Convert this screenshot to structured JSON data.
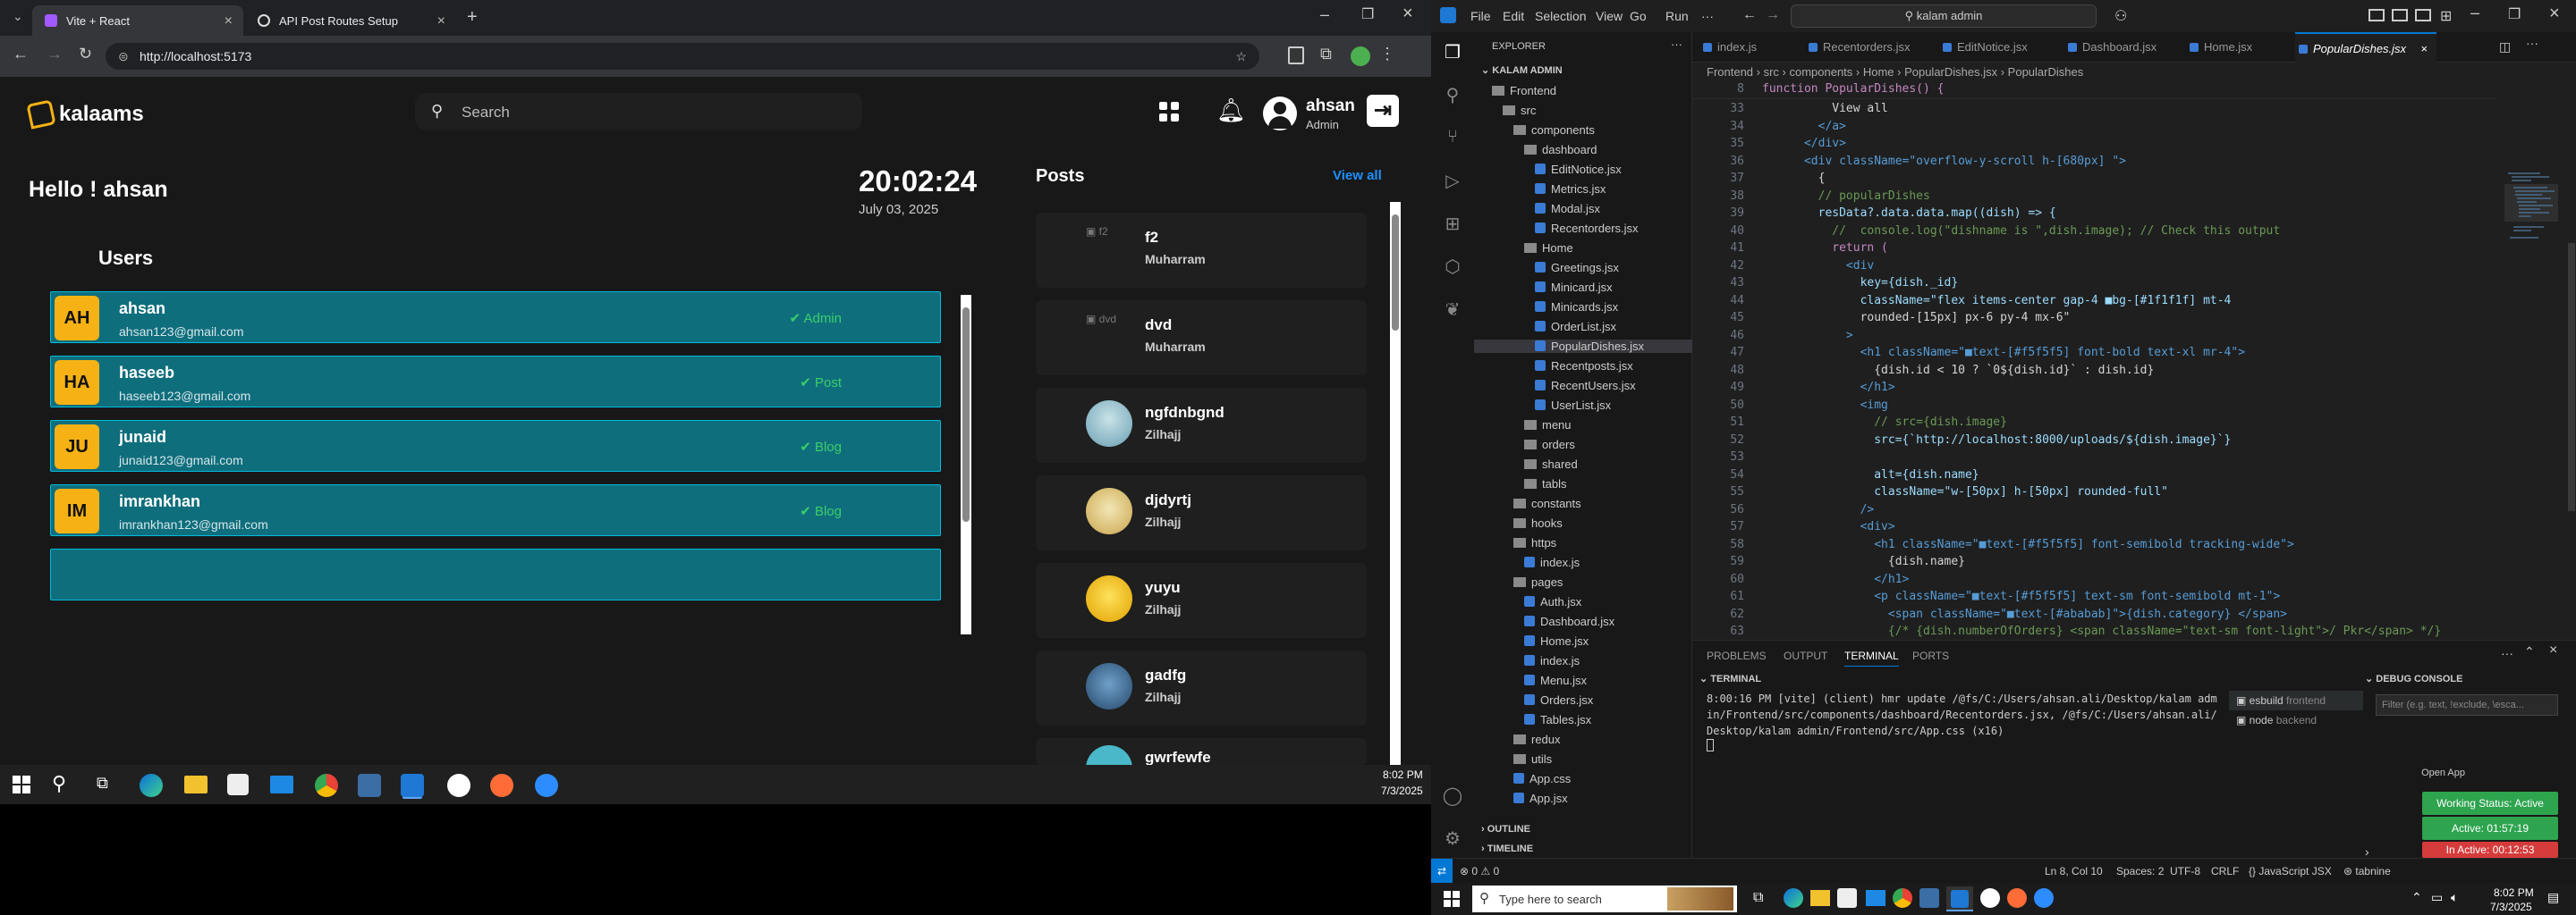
{
  "browser": {
    "tabs": [
      {
        "title": "Vite + React",
        "active": true
      },
      {
        "title": "API Post Routes Setup",
        "active": false
      }
    ],
    "new_tab": "+",
    "url": "http://localhost:5173"
  },
  "app": {
    "logo": "kalaams",
    "search_placeholder": "Search",
    "profile": {
      "name": "ahsan",
      "role": "Admin"
    },
    "greeting": "Hello ! ahsan",
    "clock": {
      "time": "20:02:24",
      "date": "July 03, 2025"
    },
    "users": {
      "title": "Users",
      "rows": [
        {
          "initials": "AH",
          "name": "ahsan",
          "email": "ahsan123@gmail.com",
          "role": "Admin"
        },
        {
          "initials": "HA",
          "name": "haseeb",
          "email": "haseeb123@gmail.com",
          "role": "Post"
        },
        {
          "initials": "JU",
          "name": "junaid",
          "email": "junaid123@gmail.com",
          "role": "Blog"
        },
        {
          "initials": "IM",
          "name": "imrankhan",
          "email": "imrankhan123@gmail.com",
          "role": "Blog"
        }
      ]
    },
    "posts": {
      "title": "Posts",
      "view_all": "View all",
      "items": [
        {
          "title": "f2",
          "sub": "Muharram",
          "img_alt": "f2"
        },
        {
          "title": "dvd",
          "sub": "Muharram",
          "img_alt": "dvd"
        },
        {
          "title": "ngfdnbgnd",
          "sub": "Zilhajj",
          "img_alt": ""
        },
        {
          "title": "djdyrtj",
          "sub": "Zilhajj",
          "img_alt": ""
        },
        {
          "title": "yuyu",
          "sub": "Zilhajj",
          "img_alt": ""
        },
        {
          "title": "gadfg",
          "sub": "Zilhajj",
          "img_alt": ""
        },
        {
          "title": "gwrfewfe",
          "sub": "",
          "img_alt": ""
        }
      ]
    }
  },
  "taskbar_left": {
    "time": "8:02 PM",
    "date": "7/3/2025"
  },
  "vscode": {
    "menus": [
      "File",
      "Edit",
      "Selection",
      "View",
      "Go",
      "Run",
      "···"
    ],
    "command_center": "kalam admin",
    "explorer": {
      "title": "EXPLORER",
      "root": "KALAM ADMIN",
      "tree": [
        {
          "label": "Frontend",
          "type": "folder",
          "depth": 1
        },
        {
          "label": "src",
          "type": "folder",
          "depth": 2
        },
        {
          "label": "components",
          "type": "folder",
          "depth": 3
        },
        {
          "label": "dashboard",
          "type": "folder",
          "depth": 4
        },
        {
          "label": "EditNotice.jsx",
          "type": "file",
          "depth": 5
        },
        {
          "label": "Metrics.jsx",
          "type": "file",
          "depth": 5
        },
        {
          "label": "Modal.jsx",
          "type": "file",
          "depth": 5
        },
        {
          "label": "Recentorders.jsx",
          "type": "file",
          "depth": 5
        },
        {
          "label": "Home",
          "type": "folder",
          "depth": 4
        },
        {
          "label": "Greetings.jsx",
          "type": "file",
          "depth": 5
        },
        {
          "label": "Minicard.jsx",
          "type": "file",
          "depth": 5
        },
        {
          "label": "Minicards.jsx",
          "type": "file",
          "depth": 5
        },
        {
          "label": "OrderList.jsx",
          "type": "file",
          "depth": 5
        },
        {
          "label": "PopularDishes.jsx",
          "type": "file",
          "depth": 5,
          "selected": true
        },
        {
          "label": "Recentposts.jsx",
          "type": "file",
          "depth": 5
        },
        {
          "label": "RecentUsers.jsx",
          "type": "file",
          "depth": 5
        },
        {
          "label": "UserList.jsx",
          "type": "file",
          "depth": 5
        },
        {
          "label": "menu",
          "type": "folder",
          "depth": 4
        },
        {
          "label": "orders",
          "type": "folder",
          "depth": 4
        },
        {
          "label": "shared",
          "type": "folder",
          "depth": 4
        },
        {
          "label": "tabls",
          "type": "folder",
          "depth": 4
        },
        {
          "label": "constants",
          "type": "folder",
          "depth": 3
        },
        {
          "label": "hooks",
          "type": "folder",
          "depth": 3
        },
        {
          "label": "https",
          "type": "folder",
          "depth": 3
        },
        {
          "label": "index.js",
          "type": "file",
          "depth": 4
        },
        {
          "label": "pages",
          "type": "folder",
          "depth": 3
        },
        {
          "label": "Auth.jsx",
          "type": "file",
          "depth": 4
        },
        {
          "label": "Dashboard.jsx",
          "type": "file",
          "depth": 4
        },
        {
          "label": "Home.jsx",
          "type": "file",
          "depth": 4
        },
        {
          "label": "index.js",
          "type": "file",
          "depth": 4
        },
        {
          "label": "Menu.jsx",
          "type": "file",
          "depth": 4
        },
        {
          "label": "Orders.jsx",
          "type": "file",
          "depth": 4
        },
        {
          "label": "Tables.jsx",
          "type": "file",
          "depth": 4
        },
        {
          "label": "redux",
          "type": "folder",
          "depth": 3
        },
        {
          "label": "utils",
          "type": "folder",
          "depth": 3
        },
        {
          "label": "App.css",
          "type": "file",
          "depth": 3
        },
        {
          "label": "App.jsx",
          "type": "file",
          "depth": 3
        }
      ],
      "outline": "OUTLINE",
      "timeline": "TIMELINE"
    },
    "editor_tabs": [
      "index.js",
      "Recentorders.jsx",
      "EditNotice.jsx",
      "Dashboard.jsx",
      "Home.jsx",
      "PopularDishes.jsx"
    ],
    "breadcrumb": "Frontend › src › components › Home › PopularDishes.jsx › PopularDishes",
    "sticky_line": {
      "num": "8",
      "text": "function PopularDishes() {"
    },
    "code": [
      {
        "n": "33",
        "t": "          View all"
      },
      {
        "n": "34",
        "t": "        </a>"
      },
      {
        "n": "35",
        "t": "      </div>"
      },
      {
        "n": "36",
        "t": "      <div className=\"overflow-y-scroll h-[680px] \">"
      },
      {
        "n": "37",
        "t": "        {"
      },
      {
        "n": "38",
        "t": "        // popularDishes"
      },
      {
        "n": "39",
        "t": "        resData?.data.data.map((dish) => {"
      },
      {
        "n": "40",
        "t": "          //  console.log(\"dishname is \",dish.image); // Check this output"
      },
      {
        "n": "41",
        "t": "          return ("
      },
      {
        "n": "42",
        "t": "            <div"
      },
      {
        "n": "43",
        "t": "              key={dish._id}"
      },
      {
        "n": "44",
        "t": "              className=\"flex items-center gap-4 ■bg-[#1f1f1f] mt-4"
      },
      {
        "n": "45",
        "t": "              rounded-[15px] px-6 py-4 mx-6\""
      },
      {
        "n": "46",
        "t": "            >"
      },
      {
        "n": "47",
        "t": "              <h1 className=\"■text-[#f5f5f5] font-bold text-xl mr-4\">"
      },
      {
        "n": "48",
        "t": "                {dish.id < 10 ? `0${dish.id}` : dish.id}"
      },
      {
        "n": "49",
        "t": "              </h1>"
      },
      {
        "n": "50",
        "t": "              <img"
      },
      {
        "n": "51",
        "t": "                // src={dish.image}"
      },
      {
        "n": "52",
        "t": "                src={`http://localhost:8000/uploads/${dish.image}`}"
      },
      {
        "n": "53",
        "t": ""
      },
      {
        "n": "54",
        "t": "                alt={dish.name}"
      },
      {
        "n": "55",
        "t": "                className=\"w-[50px] h-[50px] rounded-full\""
      },
      {
        "n": "56",
        "t": "              />"
      },
      {
        "n": "57",
        "t": "              <div>"
      },
      {
        "n": "58",
        "t": "                <h1 className=\"■text-[#f5f5f5] font-semibold tracking-wide\">"
      },
      {
        "n": "59",
        "t": "                  {dish.name}"
      },
      {
        "n": "60",
        "t": "                </h1>"
      },
      {
        "n": "61",
        "t": "                <p className=\"■text-[#f5f5f5] text-sm font-semibold mt-1\">"
      },
      {
        "n": "62",
        "t": "                  <span className=\"■text-[#ababab]\">{dish.category} </span>"
      },
      {
        "n": "63",
        "t": "                  {/* {dish.numberOfOrders} <span className=\"text-sm font-light\">/ Pkr</span> */}"
      }
    ],
    "panel": {
      "tabs": [
        "PROBLEMS",
        "OUTPUT",
        "TERMINAL",
        "PORTS"
      ],
      "active_tab": "TERMINAL",
      "terminal_header": "TERMINAL",
      "terminal_lines": [
        "8:00:16 PM [vite] (client) hmr update /@fs/C:/Users/ahsan.ali/Desktop/kalam adm",
        "in/Frontend/src/components/dashboard/Recentorders.jsx, /@fs/C:/Users/ahsan.ali/",
        "Desktop/kalam admin/Frontend/src/App.css (x16)"
      ],
      "terminals": [
        {
          "name": "esbuild",
          "tag": "frontend"
        },
        {
          "name": "node",
          "tag": "backend"
        }
      ],
      "debug_title": "DEBUG CONSOLE",
      "debug_filter": "Filter (e.g. text, !exclude, \\esca..."
    },
    "status": {
      "left": "⊗ 0 ⚠ 0",
      "position": "Ln 8, Col 10",
      "spaces": "Spaces: 2",
      "encoding": "UTF-8",
      "eol": "CRLF",
      "language": "JavaScript JSX",
      "tabnine": "tabnine"
    },
    "overlay": {
      "open_app": "Open App",
      "working": "Working Status: Active",
      "active": "Active: 01:57:19",
      "inactive": "In Active: 00:12:53"
    }
  },
  "taskbar": {
    "search_placeholder": "Type here to search",
    "time": "8:02 PM",
    "date": "7/3/2025"
  }
}
